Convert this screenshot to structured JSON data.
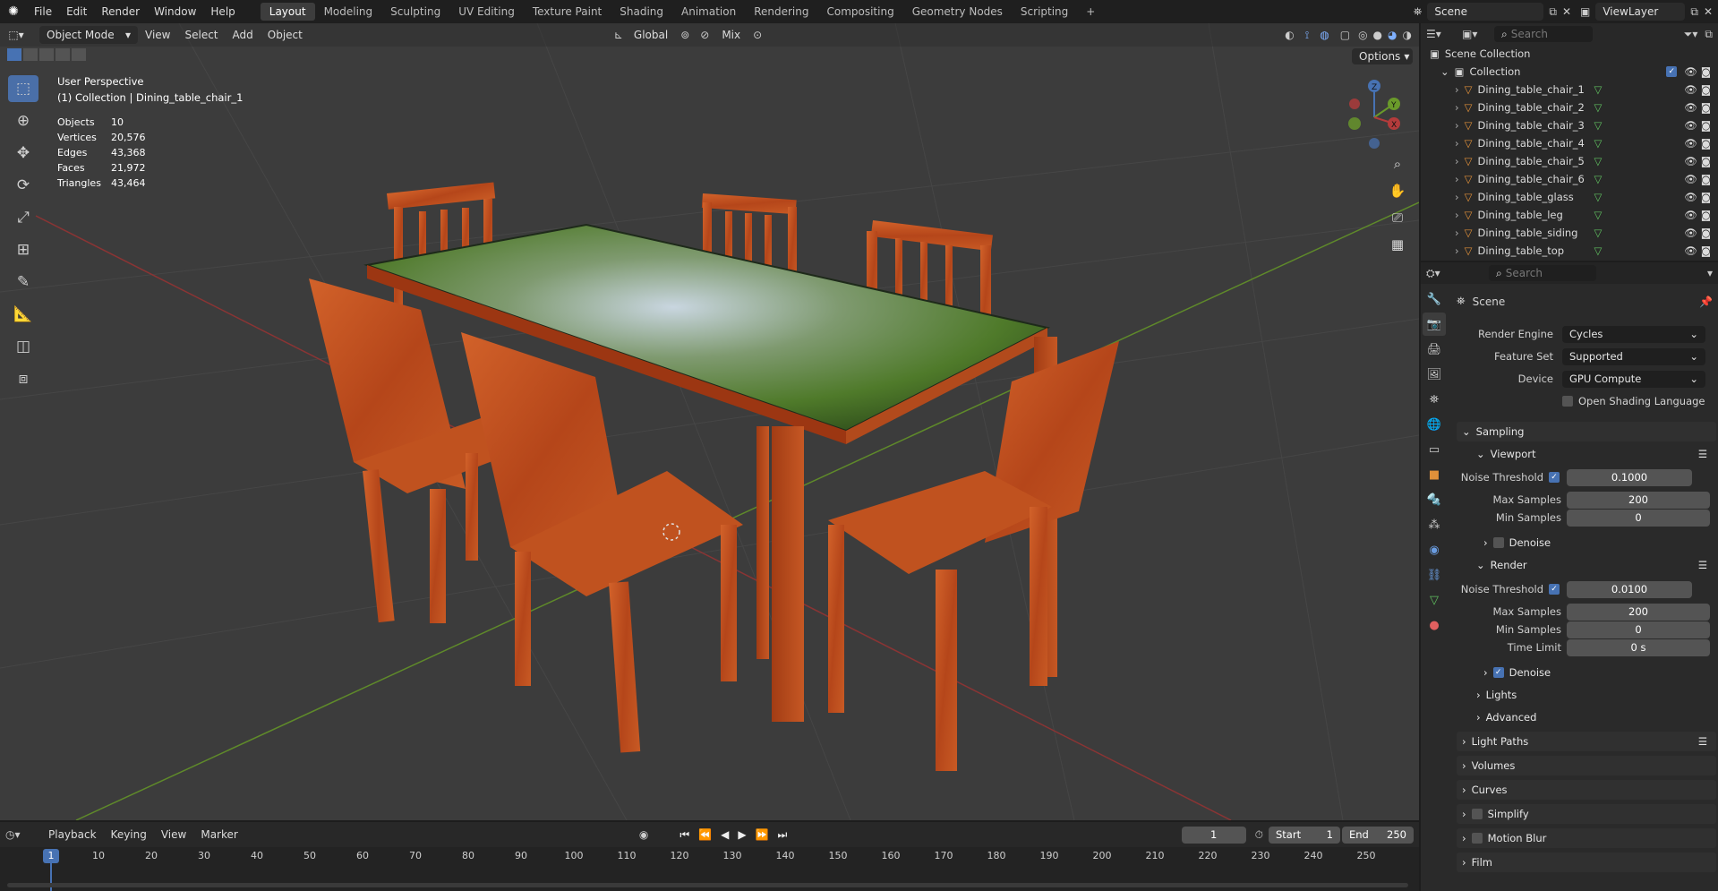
{
  "menu": [
    "File",
    "Edit",
    "Render",
    "Window",
    "Help"
  ],
  "workspaces": [
    "Layout",
    "Modeling",
    "Sculpting",
    "UV Editing",
    "Texture Paint",
    "Shading",
    "Animation",
    "Rendering",
    "Compositing",
    "Geometry Nodes",
    "Scripting"
  ],
  "add_workspace": "+",
  "scene_name": "Scene",
  "view_layer": "ViewLayer",
  "viewport": {
    "mode": "Object Mode",
    "menus": [
      "View",
      "Select",
      "Add",
      "Object"
    ],
    "orientation": "Global",
    "pivot": "Mix",
    "options": "Options",
    "view_name": "User Perspective",
    "collection_info": "(1) Collection | Dining_table_chair_1",
    "stats": [
      {
        "label": "Objects",
        "value": "10"
      },
      {
        "label": "Vertices",
        "value": "20,576"
      },
      {
        "label": "Edges",
        "value": "43,368"
      },
      {
        "label": "Faces",
        "value": "21,972"
      },
      {
        "label": "Triangles",
        "value": "43,464"
      }
    ],
    "gizmo": {
      "z": "Z",
      "y": "Y",
      "x": "X"
    }
  },
  "outliner": {
    "search_placeholder": "Search",
    "scene_collection": "Scene Collection",
    "collection": "Collection",
    "items": [
      "Dining_table_chair_1",
      "Dining_table_chair_2",
      "Dining_table_chair_3",
      "Dining_table_chair_4",
      "Dining_table_chair_5",
      "Dining_table_chair_6",
      "Dining_table_glass",
      "Dining_table_leg",
      "Dining_table_siding",
      "Dining_table_top"
    ]
  },
  "properties": {
    "search_placeholder": "Search",
    "context": "Scene",
    "render_engine_label": "Render Engine",
    "render_engine": "Cycles",
    "feature_set_label": "Feature Set",
    "feature_set": "Supported",
    "device_label": "Device",
    "device": "GPU Compute",
    "osl_label": "Open Shading Language",
    "sampling": "Sampling",
    "viewport": "Viewport",
    "noise_threshold_label": "Noise Threshold",
    "viewport_noise": "0.1000",
    "max_samples_label": "Max Samples",
    "viewport_max": "200",
    "min_samples_label": "Min Samples",
    "viewport_min": "0",
    "denoise_label": "Denoise",
    "render": "Render",
    "render_noise": "0.0100",
    "render_max": "200",
    "render_min": "0",
    "time_limit_label": "Time Limit",
    "time_limit": "0 s",
    "lights": "Lights",
    "advanced": "Advanced",
    "light_paths": "Light Paths",
    "volumes": "Volumes",
    "curves": "Curves",
    "simplify": "Simplify",
    "motion_blur": "Motion Blur",
    "film": "Film"
  },
  "timeline": {
    "menus": [
      "Playback",
      "Keying",
      "View",
      "Marker"
    ],
    "current_frame": "1",
    "start_label": "Start",
    "start": "1",
    "end_label": "End",
    "end": "250",
    "ticks": [
      "10",
      "20",
      "30",
      "40",
      "50",
      "60",
      "70",
      "80",
      "90",
      "100",
      "110",
      "120",
      "130",
      "140",
      "150",
      "160",
      "170",
      "180",
      "190",
      "200",
      "210",
      "220",
      "230",
      "240",
      "250"
    ]
  },
  "colors": {
    "accent": "#4772b3",
    "wood": "#c0501e",
    "x_axis": "#b33b3b",
    "y_axis": "#6a9a2a"
  }
}
